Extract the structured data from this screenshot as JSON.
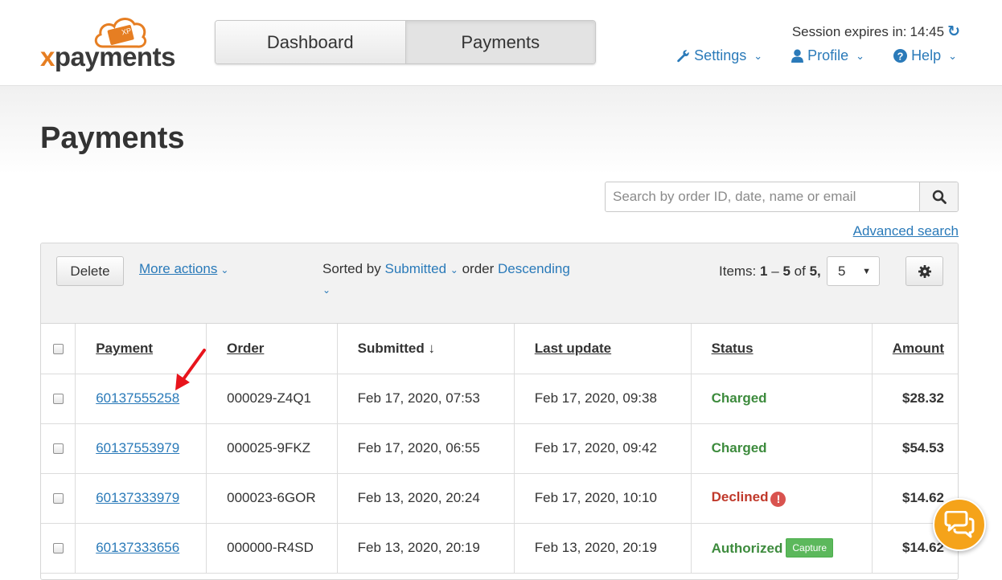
{
  "logo": {
    "text_prefix": "x",
    "text_rest": "payments",
    "badge": "XP"
  },
  "nav": {
    "tabs": [
      {
        "label": "Dashboard"
      },
      {
        "label": "Payments"
      }
    ]
  },
  "session": {
    "label": "Session expires in:",
    "time": "14:45"
  },
  "top_menu": [
    {
      "label": "Settings",
      "icon": "wrench-icon"
    },
    {
      "label": "Profile",
      "icon": "user-icon"
    },
    {
      "label": "Help",
      "icon": "question-circle-icon"
    }
  ],
  "page": {
    "title": "Payments"
  },
  "search": {
    "placeholder": "Search by order ID, date, name or email",
    "advanced_label": "Advanced search"
  },
  "toolbar": {
    "delete_label": "Delete",
    "more_actions_label": "More actions",
    "sorted_by_label": "Sorted by",
    "sort_field": "Submitted",
    "order_label": "order",
    "sort_order": "Descending",
    "items_label": "Items:",
    "items_from": "1",
    "items_dash": "–",
    "items_to": "5",
    "items_of": "of",
    "items_total": "5,",
    "per_page": "5"
  },
  "table": {
    "headers": {
      "payment": "Payment",
      "order": "Order",
      "submitted": "Submitted ↓",
      "last_update": "Last update",
      "status": "Status",
      "amount": "Amount"
    },
    "rows": [
      {
        "payment": "60137555258",
        "order": "000029-Z4Q1",
        "submitted": "Feb 17, 2020, 07:53",
        "last_update": "Feb 17, 2020, 09:38",
        "status": "Charged",
        "amount": "$28.32"
      },
      {
        "payment": "60137553979",
        "order": "000025-9FKZ",
        "submitted": "Feb 17, 2020, 06:55",
        "last_update": "Feb 17, 2020, 09:42",
        "status": "Charged",
        "amount": "$54.53"
      },
      {
        "payment": "60137333979",
        "order": "000023-6GOR",
        "submitted": "Feb 13, 2020, 20:24",
        "last_update": "Feb 17, 2020, 10:10",
        "status": "Declined",
        "amount": "$14.62"
      },
      {
        "payment": "60137333656",
        "order": "000000-R4SD",
        "submitted": "Feb 13, 2020, 20:19",
        "last_update": "Feb 13, 2020, 20:19",
        "status": "Authorized",
        "action": "Capture",
        "amount": "$14.62"
      }
    ]
  },
  "colors": {
    "link": "#2a7ab9",
    "accent": "#e67e22",
    "success": "#3d8b3d",
    "danger": "#c0392b",
    "chat": "#f5a31a"
  }
}
